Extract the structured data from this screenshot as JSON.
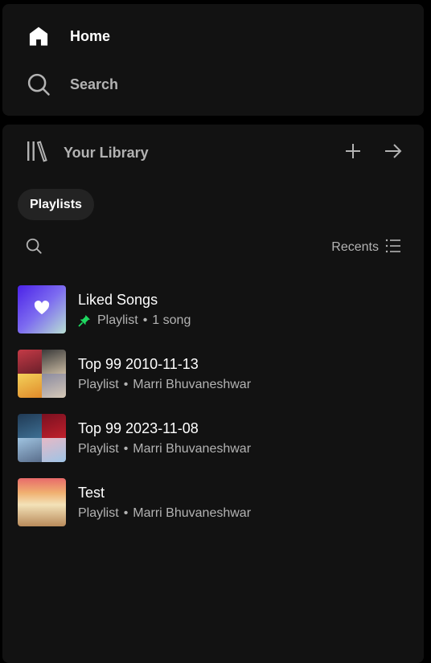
{
  "nav": {
    "home_label": "Home",
    "search_label": "Search"
  },
  "library": {
    "title": "Your Library",
    "chip_label": "Playlists",
    "sort_label": "Recents",
    "items": [
      {
        "title": "Liked Songs",
        "type": "Playlist",
        "detail": "1 song",
        "pinned": true
      },
      {
        "title": "Top 99 2010-11-13",
        "type": "Playlist",
        "detail": "Marri Bhuvaneshwar"
      },
      {
        "title": "Top 99 2023-11-08",
        "type": "Playlist",
        "detail": "Marri Bhuvaneshwar"
      },
      {
        "title": "Test",
        "type": "Playlist",
        "detail": "Marri Bhuvaneshwar"
      }
    ]
  },
  "colors": {
    "background": "#000000",
    "panel": "#121212",
    "chip": "#232323",
    "secondary_text": "#b3b3b3",
    "pin_green": "#1ed760"
  },
  "icons": {
    "home": "home-icon",
    "search": "search-icon",
    "library": "library-icon",
    "add": "plus-icon",
    "expand": "arrow-right-icon",
    "sort": "list-icon",
    "pin": "pin-icon",
    "heart": "heart-icon"
  },
  "dot": "•"
}
